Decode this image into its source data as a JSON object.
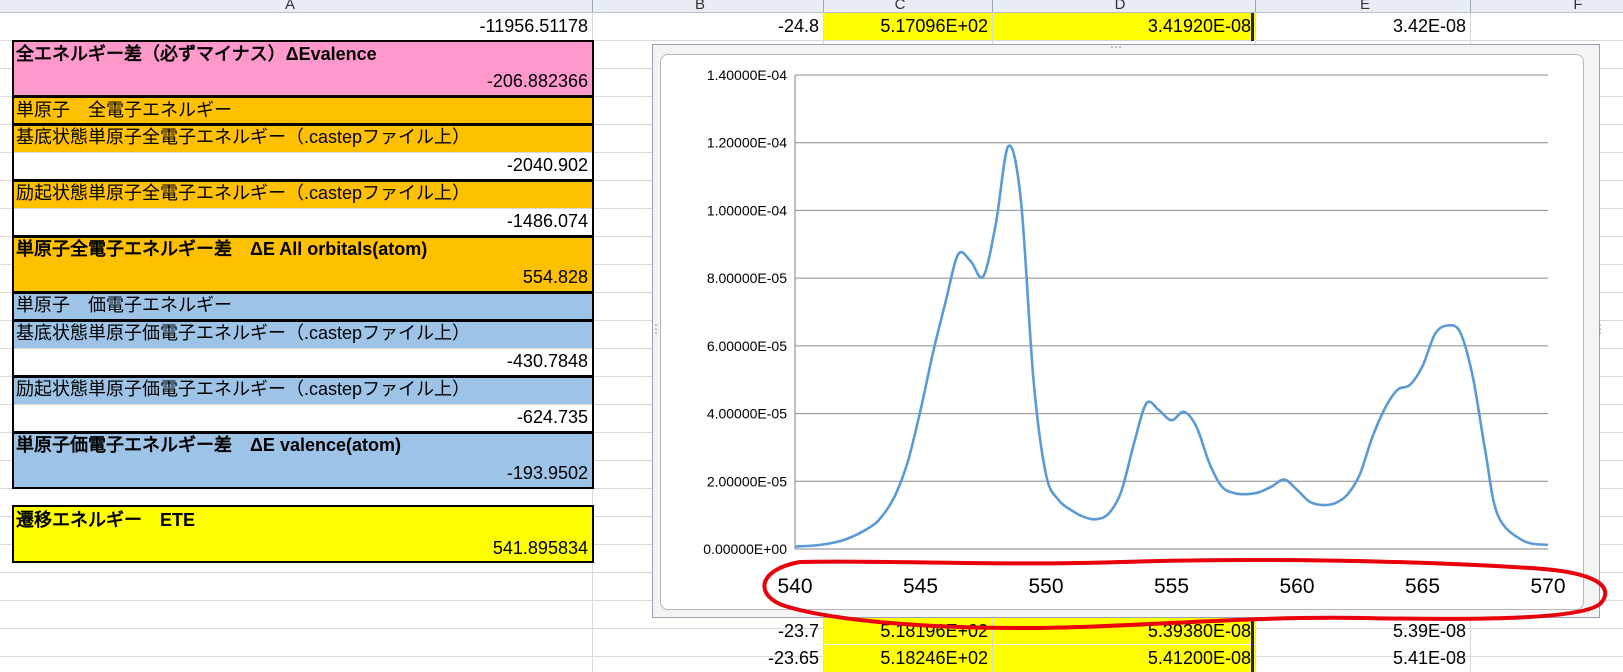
{
  "columns": [
    "A",
    "B",
    "C",
    "D",
    "E",
    "F"
  ],
  "left_panel": {
    "row_top_value": "-11956.51178",
    "evalence_label": "全エネルギー差（必ずマイナス）ΔEvalence",
    "evalence_value": "-206.882366",
    "single_atom_all_title": "単原子　全電子エネルギー",
    "ground_all_label": "基底状態単原子全電子エネルギー（.castepファイル上）",
    "ground_all_value": "-2040.902",
    "excited_all_label": "励起状態単原子全電子エネルギー（.castepファイル上）",
    "excited_all_value": "-1486.074",
    "diff_all_label": "単原子全電子エネルギー差　ΔE All orbitals(atom)",
    "diff_all_value": "554.828",
    "single_atom_val_title": "単原子　価電子エネルギー",
    "ground_val_label": "基底状態単原子価電子エネルギー（.castepファイル上）",
    "ground_val_value": "-430.7848",
    "excited_val_label": "励起状態単原子価電子エネルギー（.castepファイル上）",
    "excited_val_value": "-624.735",
    "diff_val_label": "単原子価電子エネルギー差　ΔE valence(atom)",
    "diff_val_value": "-193.9502",
    "ete_label": "遷移エネルギー　ETE",
    "ete_value": "541.895834"
  },
  "grid_rows": {
    "top": {
      "b": "-24.8",
      "c": "5.17096E+02",
      "d": "3.41920E-08",
      "e": "3.42E-08"
    },
    "bottom1": {
      "b": "-23.7",
      "c": "5.18196E+02",
      "d": "5.39380E-08",
      "e": "5.39E-08"
    },
    "bottom2": {
      "b": "-23.65",
      "c": "5.18246E+02",
      "d": "5.41200E-08",
      "e": "5.41E-08"
    }
  },
  "colors": {
    "pink": "#ff99cc",
    "orange": "#ffc000",
    "blue": "#9dc3e6",
    "yellow": "#ffff00",
    "line": "#5b9bd5",
    "annotation": "#e8000b"
  },
  "chart_data": {
    "type": "line",
    "xlim": [
      540,
      570
    ],
    "ylim": [
      0,
      0.00014
    ],
    "x_ticks": [
      "540",
      "545",
      "550",
      "555",
      "560",
      "565",
      "570"
    ],
    "y_ticks": [
      "0.00000E+00",
      "2.00000E-05",
      "4.00000E-05",
      "6.00000E-05",
      "8.00000E-05",
      "1.00000E-04",
      "1.20000E-04",
      "1.40000E-04"
    ],
    "grid": true,
    "annotation": "red freehand ellipse around x-axis labels",
    "series": [
      {
        "x": [
          540,
          541,
          542,
          543,
          543.5,
          544,
          544.5,
          545,
          545.5,
          546,
          546.5,
          547,
          547.5,
          548,
          548.5,
          549,
          549.5,
          550,
          550.5,
          551,
          551.5,
          552,
          552.5,
          553,
          553.5,
          554,
          554.5,
          555,
          555.5,
          556,
          556.5,
          557,
          557.5,
          558,
          558.5,
          559,
          559.5,
          560,
          560.5,
          561,
          561.5,
          562,
          562.5,
          563,
          563.5,
          564,
          564.5,
          565,
          565.5,
          566,
          566.5,
          567,
          567.5,
          568,
          569,
          570
        ],
        "y": [
          7e-07,
          1.2e-06,
          2.8e-06,
          6.5e-06,
          1e-05,
          1.6e-05,
          2.6e-05,
          4.1e-05,
          5.8e-05,
          7.3e-05,
          8.7e-05,
          8.5e-05,
          8.05e-05,
          9.6e-05,
          0.000119,
          0.000103,
          5e-05,
          2.2e-05,
          1.45e-05,
          1.15e-05,
          9.5e-06,
          8.8e-06,
          1.05e-05,
          1.7e-05,
          3.1e-05,
          4.3e-05,
          4.1e-05,
          3.8e-05,
          4.05e-05,
          3.6e-05,
          2.55e-05,
          1.85e-05,
          1.65e-05,
          1.62e-05,
          1.68e-05,
          1.85e-05,
          2.05e-05,
          1.75e-05,
          1.4e-05,
          1.3e-05,
          1.35e-05,
          1.6e-05,
          2.2e-05,
          3.3e-05,
          4.15e-05,
          4.7e-05,
          4.85e-05,
          5.4e-05,
          6.35e-05,
          6.6e-05,
          6.4e-05,
          5.1e-05,
          2.9e-05,
          1e-05,
          2.5e-06,
          1.2e-06
        ]
      }
    ]
  }
}
